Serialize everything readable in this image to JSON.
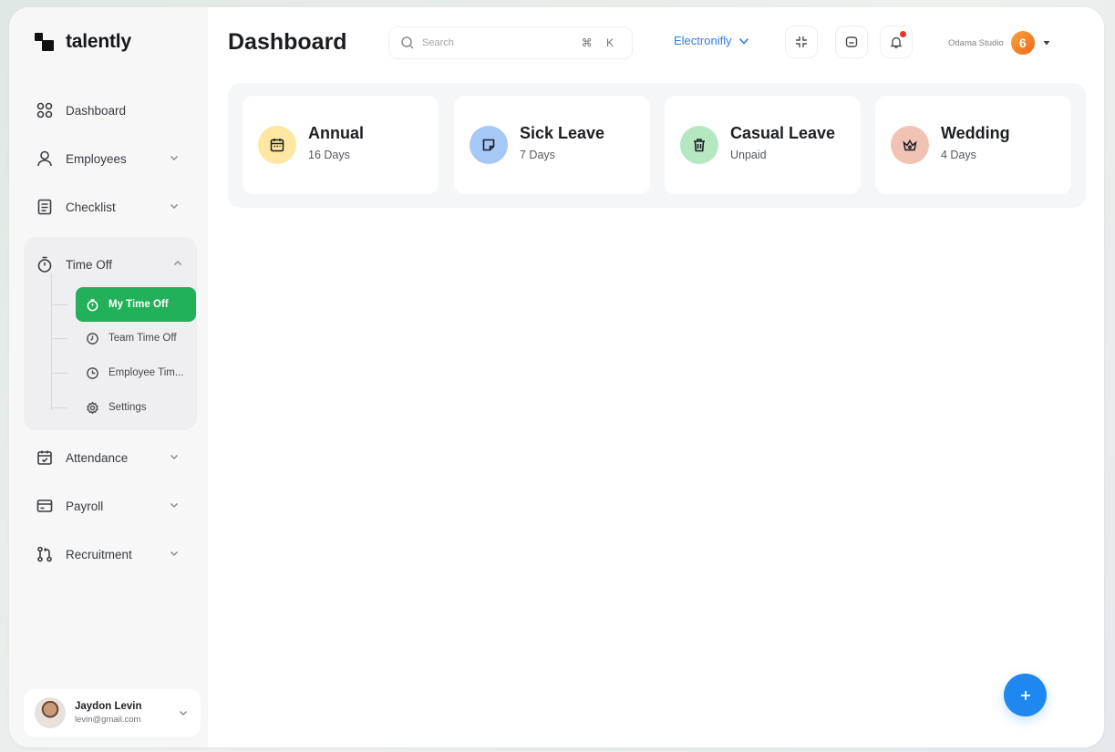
{
  "app": {
    "brand": "talently"
  },
  "header": {
    "title": "Dashboard",
    "search": {
      "placeholder": "Search",
      "value": "",
      "shortcut": "⌘ K"
    },
    "organization": "Electronifly",
    "workspace": {
      "name": "Odama Studio",
      "logo_glyph": "6"
    }
  },
  "sidebar": {
    "items": [
      {
        "label": "Dashboard",
        "icon": "grid-icon"
      },
      {
        "label": "Employees",
        "icon": "user-icon"
      },
      {
        "label": "Checklist",
        "icon": "checklist-icon"
      },
      {
        "label": "Time Off",
        "icon": "stopwatch-icon"
      },
      {
        "label": "Attendance",
        "icon": "calendar-check-icon"
      },
      {
        "label": "Payroll",
        "icon": "wallet-icon"
      },
      {
        "label": "Recruitment",
        "icon": "git-pull-icon"
      }
    ],
    "time_off_sub": [
      {
        "label": "My Time Off",
        "icon": "timer-icon",
        "active": true
      },
      {
        "label": "Team Time Off",
        "icon": "clock-icon"
      },
      {
        "label": "Employee Tim...",
        "icon": "clock-icon"
      },
      {
        "label": "Settings",
        "icon": "gear-icon"
      }
    ],
    "user": {
      "name": "Jaydon Levin",
      "email": "levin@gmail.com"
    }
  },
  "leave_cards": [
    {
      "title": "Annual",
      "subtitle": "16 Days",
      "icon": "calendar-icon",
      "color": "#fde7a1"
    },
    {
      "title": "Sick Leave",
      "subtitle": "7 Days",
      "icon": "sticky-note-icon",
      "color": "#a6c8f7"
    },
    {
      "title": "Casual Leave",
      "subtitle": "Unpaid",
      "icon": "trash-icon",
      "color": "#b5e8c0"
    },
    {
      "title": "Wedding",
      "subtitle": "4 Days",
      "icon": "crown-icon",
      "color": "#f1c3b5"
    }
  ],
  "colors": {
    "accent_green": "#22b05a",
    "accent_blue": "#1f87f0",
    "link_blue": "#2f7ee6"
  }
}
